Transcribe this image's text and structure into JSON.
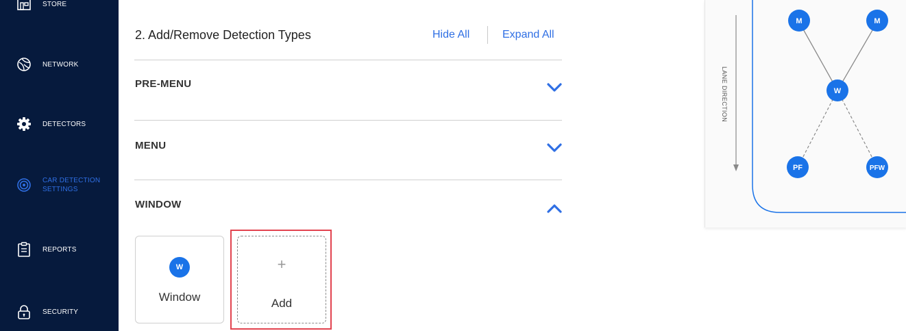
{
  "sidebar": {
    "items": [
      {
        "label": "STORE",
        "icon": "store-icon"
      },
      {
        "label": "NETWORK",
        "icon": "network-icon"
      },
      {
        "label": "DETECTORS",
        "icon": "gear-icon"
      },
      {
        "label": "CAR DETECTION SETTINGS",
        "icon": "radar-icon",
        "active": true
      },
      {
        "label": "REPORTS",
        "icon": "clipboard-icon"
      },
      {
        "label": "SECURITY",
        "icon": "lock-icon"
      }
    ]
  },
  "main": {
    "section_title": "2. Add/Remove Detection Types",
    "hide_all": "Hide All",
    "expand_all": "Expand All",
    "accordions": [
      {
        "label": "PRE-MENU",
        "expanded": false
      },
      {
        "label": "MENU",
        "expanded": false
      },
      {
        "label": "WINDOW",
        "expanded": true
      }
    ],
    "window_card": {
      "badge": "W",
      "label": "Window"
    },
    "add_card": {
      "plus": "+",
      "label": "Add"
    }
  },
  "diagram": {
    "lane_label": "LANE DIRECTION",
    "nodes": {
      "m1": "M",
      "m2": "M",
      "w": "W",
      "pf": "PF",
      "pfw": "PFW"
    }
  },
  "colors": {
    "sidebar_bg": "#061a3d",
    "accent": "#2f6fe4",
    "badge": "#1a73e8",
    "highlight": "#e2434f"
  }
}
